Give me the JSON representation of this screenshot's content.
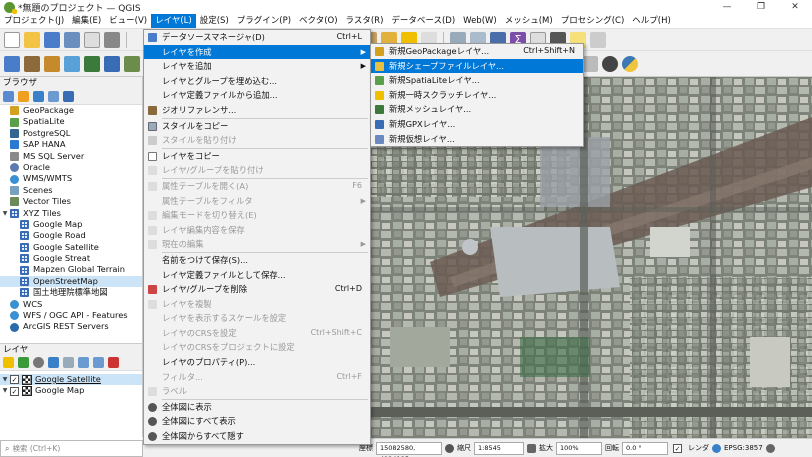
{
  "window": {
    "title": "*無題のプロジェクト — QGIS",
    "minimize": "—",
    "maximize": "❐",
    "close": "✕"
  },
  "menubar": [
    "プロジェクト(J)",
    "編集(E)",
    "ビュー(V)",
    "レイヤ(L)",
    "設定(S)",
    "プラグイン(P)",
    "ベクタ(O)",
    "ラスタ(R)",
    "データベース(D)",
    "Web(W)",
    "メッシュ(M)",
    "プロセシング(C)",
    "ヘルプ(H)"
  ],
  "browser": {
    "title": "ブラウザ",
    "items": [
      {
        "label": "GeoPackage",
        "icon": "geopackage-icon"
      },
      {
        "label": "SpatiaLite",
        "icon": "spatialite-icon"
      },
      {
        "label": "PostgreSQL",
        "icon": "postgresql-icon"
      },
      {
        "label": "SAP HANA",
        "icon": "sap-hana-icon"
      },
      {
        "label": "MS SQL Server",
        "icon": "mssql-icon"
      },
      {
        "label": "Oracle",
        "icon": "oracle-icon"
      },
      {
        "label": "WMS/WMTS",
        "icon": "wms-icon"
      },
      {
        "label": "Scenes",
        "icon": "scenes-icon"
      },
      {
        "label": "Vector Tiles",
        "icon": "vector-tiles-icon"
      },
      {
        "label": "XYZ Tiles",
        "icon": "xyz-tiles-icon"
      },
      {
        "label": "Google Map",
        "icon": "grid-icon"
      },
      {
        "label": "Google Road",
        "icon": "grid-icon"
      },
      {
        "label": "Google Satellite",
        "icon": "grid-icon"
      },
      {
        "label": "Google Streat",
        "icon": "grid-icon"
      },
      {
        "label": "Mapzen Global Terrain",
        "icon": "grid-icon"
      },
      {
        "label": "OpenStreetMap",
        "icon": "grid-icon"
      },
      {
        "label": "国土地理院標準地図",
        "icon": "grid-icon"
      },
      {
        "label": "WCS",
        "icon": "wcs-icon"
      },
      {
        "label": "WFS / OGC API - Features",
        "icon": "wfs-icon"
      },
      {
        "label": "ArcGIS REST Servers",
        "icon": "arcgis-icon"
      }
    ]
  },
  "layers": {
    "title": "レイヤ",
    "items": [
      {
        "label": "Google Satellite",
        "checked": "✓"
      },
      {
        "label": "Google Map",
        "checked": "✓"
      }
    ]
  },
  "search": {
    "placeholder": "検索 (Ctrl+K)"
  },
  "layer_menu": [
    {
      "label": "データソースマネージャ(D)",
      "shortcut": "Ctrl+L",
      "enabled": true
    },
    {
      "label": "レイヤを作成",
      "arrow": "▶",
      "enabled": true,
      "highlighted": true
    },
    {
      "label": "レイヤを追加",
      "arrow": "▶",
      "enabled": true
    },
    {
      "label": "レイヤとグループを埋め込む...",
      "enabled": true
    },
    {
      "label": "レイヤ定義ファイルから追加...",
      "enabled": true
    },
    {
      "label": "ジオリファレンサ...",
      "enabled": true
    },
    {
      "label": "スタイルをコピー",
      "enabled": true
    },
    {
      "label": "スタイルを貼り付け",
      "enabled": false
    },
    {
      "label": "レイヤをコピー",
      "enabled": true
    },
    {
      "label": "レイヤ/グループを貼り付け",
      "enabled": false
    },
    {
      "label": "属性テーブルを開く(A)",
      "shortcut": "F6",
      "enabled": false
    },
    {
      "label": "属性テーブルをフィルタ",
      "arrow": "▶",
      "enabled": false
    },
    {
      "label": "編集モードを切り替え(E)",
      "enabled": false
    },
    {
      "label": "レイヤ編集内容を保存",
      "enabled": false
    },
    {
      "label": "現在の編集",
      "arrow": "▶",
      "enabled": false
    },
    {
      "label": "名前をつけて保存(S)...",
      "enabled": true
    },
    {
      "label": "レイヤ定義ファイルとして保存...",
      "enabled": true
    },
    {
      "label": "レイヤ/グループを削除",
      "shortcut": "Ctrl+D",
      "enabled": true
    },
    {
      "label": "レイヤを複製",
      "enabled": false
    },
    {
      "label": "レイヤを表示するスケールを設定",
      "enabled": false
    },
    {
      "label": "レイヤのCRSを設定",
      "shortcut": "Ctrl+Shift+C",
      "enabled": false
    },
    {
      "label": "レイヤのCRSをプロジェクトに設定",
      "enabled": false
    },
    {
      "label": "レイヤのプロパティ(P)...",
      "enabled": true
    },
    {
      "label": "フィルタ...",
      "shortcut": "Ctrl+F",
      "enabled": false
    },
    {
      "label": "ラベル",
      "enabled": false
    },
    {
      "label": "全体図に表示",
      "enabled": true
    },
    {
      "label": "全体図にすべて表示",
      "enabled": true
    },
    {
      "label": "全体図からすべて隠す",
      "enabled": true
    }
  ],
  "create_layer_menu": [
    {
      "label": "新規GeoPackageレイヤ...",
      "shortcut": "Ctrl+Shift+N"
    },
    {
      "label": "新規シェープファイルレイヤ...",
      "highlighted": true
    },
    {
      "label": "新規SpatiaLiteレイヤ..."
    },
    {
      "label": "新規一時スクラッチレイヤ..."
    },
    {
      "label": "新規メッシュレイヤ..."
    },
    {
      "label": "新規GPXレイヤ..."
    },
    {
      "label": "新規仮想レイヤ..."
    }
  ],
  "status": {
    "coord_label": "座標",
    "coord_value": "15082580, 4124185",
    "scale_label": "縮尺",
    "scale_value": "1:8545",
    "magnifier_label": "拡大",
    "magnifier_value": "100%",
    "rotation_label": "回転",
    "rotation_value": "0.0 °",
    "render_label": "レンダ",
    "crs": "EPSG:3857"
  },
  "colors": {
    "accent": "#0078d7",
    "qgis_green": "#589632"
  }
}
